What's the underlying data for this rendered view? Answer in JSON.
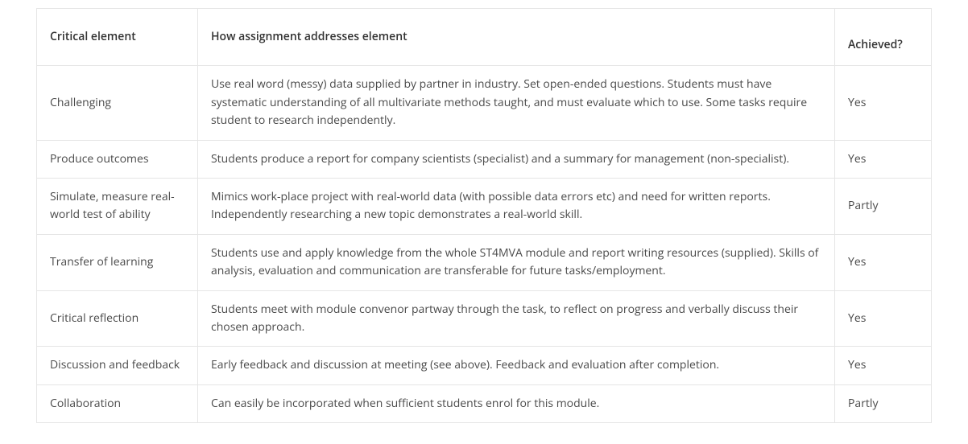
{
  "table": {
    "headers": {
      "element": "Critical  element",
      "how": "How  assignment addresses element",
      "achieved": "Achieved?"
    },
    "rows": [
      {
        "element": "Challenging",
        "how": "Use real word (messy) data supplied by partner in industry. Set open-ended questions. Students must have systematic understanding of all multivariate methods taught, and must evaluate which to use. Some tasks require student to research independently.",
        "achieved": "Yes"
      },
      {
        "element": "Produce outcomes",
        "how": "Students produce a report for company scientists (specialist) and a summary for management (non-specialist).",
        "achieved": "Yes"
      },
      {
        "element": "Simulate, measure real-world test of ability",
        "how": "Mimics work-place project with real-world data (with possible data errors etc) and need for written reports. Independently researching a new topic demonstrates a real-world skill.",
        "achieved": "Partly"
      },
      {
        "element": "Transfer of learning",
        "how": "Students use and apply knowledge from the whole ST4MVA module and report writing resources (supplied). Skills of analysis, evaluation and communication are transferable for future tasks/employment.",
        "achieved": "Yes"
      },
      {
        "element": "Critical reflection",
        "how": "Students meet with module convenor partway through the task, to reflect on progress and verbally discuss their chosen approach.",
        "achieved": "Yes"
      },
      {
        "element": "Discussion and feedback",
        "how": "Early feedback and discussion at meeting (see above). Feedback and evaluation after completion.",
        "achieved": "Yes"
      },
      {
        "element": "Collaboration",
        "how": "Can easily be incorporated when sufficient students enrol for this module.",
        "achieved": "Partly"
      }
    ]
  }
}
